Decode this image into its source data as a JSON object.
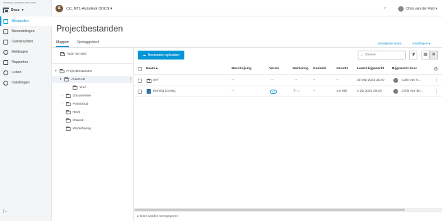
{
  "brand": {
    "text": "AUTODESK CONSTRUCTION CLOUD"
  },
  "app": {
    "name": "Docs",
    "caret": "▾"
  },
  "sidebar": {
    "items": [
      {
        "label": "Bestanden",
        "icon": "file-icon"
      },
      {
        "label": "Beoordelingen",
        "icon": "review-icon"
      },
      {
        "label": "Overdrachten",
        "icon": "transmittal-icon"
      },
      {
        "label": "Meldingen",
        "icon": "issue-icon"
      },
      {
        "label": "Rapporten",
        "icon": "report-icon"
      },
      {
        "label": "Leden",
        "icon": "members-icon"
      },
      {
        "label": "Instellingen",
        "icon": "settings-icon"
      }
    ],
    "collapse": "|←"
  },
  "topbar": {
    "project_name": "CC_NT1-Autodesk DOCS",
    "project_logo": "&",
    "help": "?",
    "user_name": "Chris van der Fluit",
    "caret": "▾"
  },
  "page": {
    "title": "Projectbestanden",
    "tabs": [
      "Mappen",
      "Opslaggebied"
    ],
    "link_deleted": "Verwijderde items",
    "link_settings": "Instellingen ▾"
  },
  "tree": {
    "upload_field": "Voor het veld",
    "items": [
      {
        "label": "Projectbestanden",
        "chevron": "▾"
      },
      {
        "label": "AutoCAD",
        "chevron": "▾"
      },
      {
        "label": "Xref",
        "chevron": ""
      },
      {
        "label": "Documenten",
        "chevron": "›"
      },
      {
        "label": "Pointcloud",
        "chevron": "›"
      },
      {
        "label": "Revit",
        "chevron": ""
      },
      {
        "label": "Shared",
        "chevron": ""
      },
      {
        "label": "Worksharing",
        "chevron": ""
      }
    ],
    "more": "⋮"
  },
  "toolbar": {
    "upload_label": "Bestanden uploaden",
    "search_placeholder": "Zoeken",
    "filter": "⧩",
    "grid": "▦",
    "list": "≣"
  },
  "table": {
    "headers": {
      "naam": "Naam ▴",
      "beschrijving": "Beschrijving",
      "versie": "Versie",
      "markering": "Markering",
      "gedeeld": "Gedeeld",
      "grootte": "Grootte",
      "bijgewerkt": "Laatst bijgewerkt",
      "door": "Bijgewerkt door"
    },
    "rows": [
      {
        "name": "xref",
        "type": "folder",
        "description": "--",
        "version": "--",
        "markup": "--",
        "shared": "--",
        "size": "--",
        "updated": "30 sep 2021 15:40",
        "updated_by": "Colin van K..."
      },
      {
        "name": "Woning 10.dwg",
        "type": "dwg",
        "description": "--",
        "version": "V1",
        "markup": "⚲ ▭",
        "shared": "--",
        "size": "2,5 MB",
        "updated": "4 jan 2022 09:23",
        "updated_by": "Chris van de..."
      }
    ],
    "row_more": "⋮",
    "settings": "⚙"
  },
  "status": {
    "text": "2 items worden weergegeven"
  },
  "colors": {
    "accent": "#0696d7",
    "sidebar_bg": "#f4f5f6"
  }
}
